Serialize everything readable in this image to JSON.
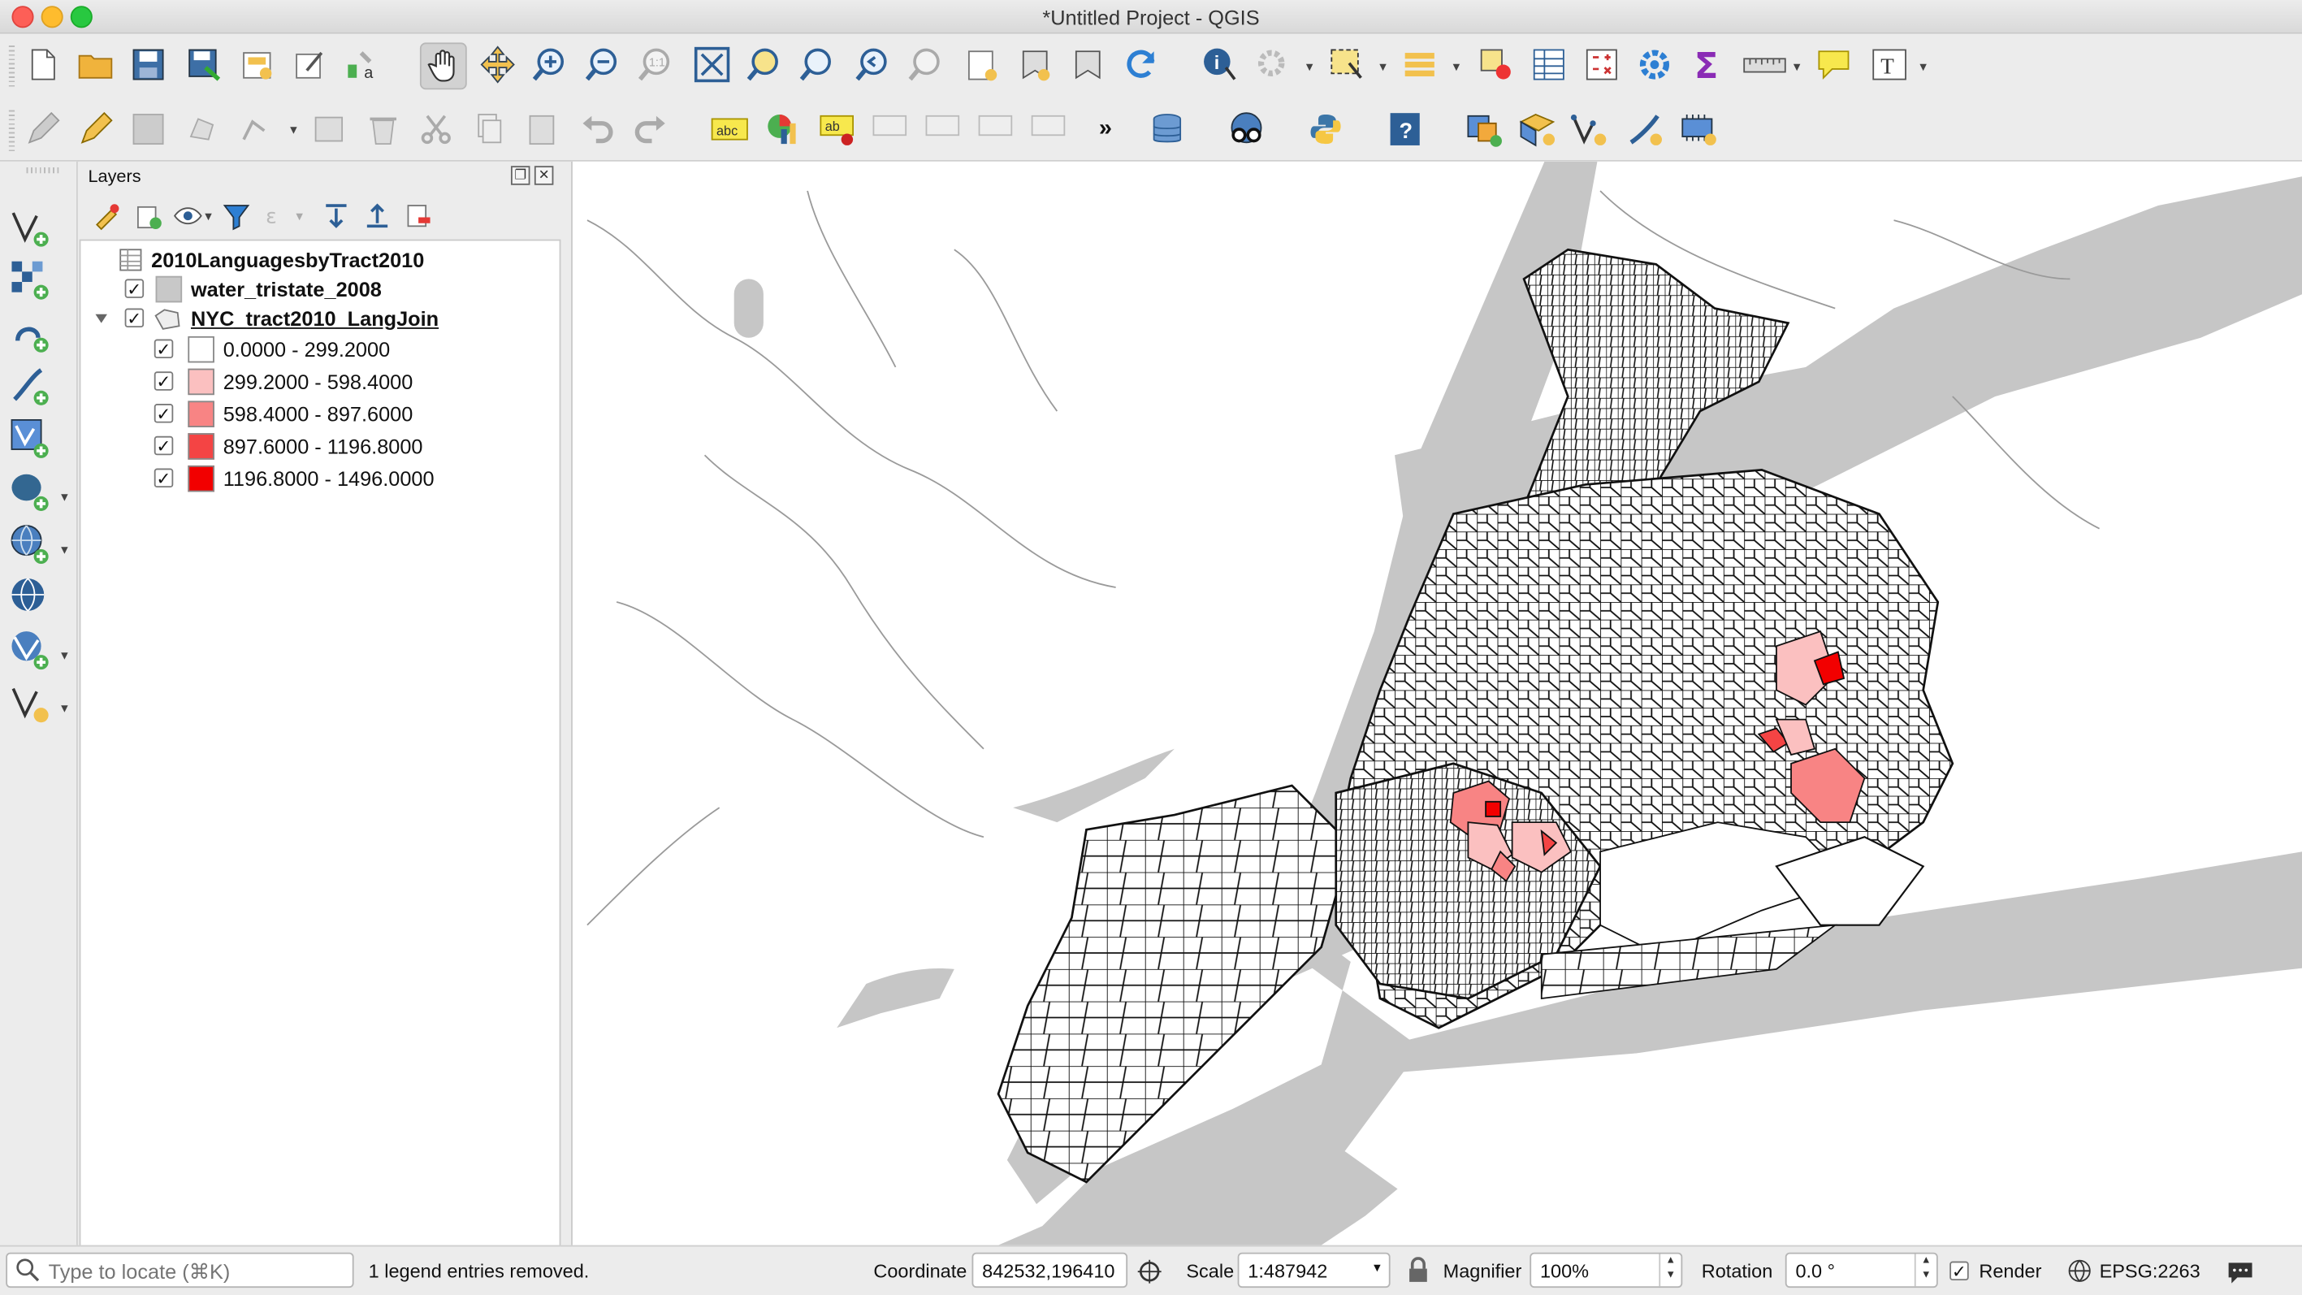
{
  "window": {
    "title": "*Untitled Project - QGIS"
  },
  "layers_panel": {
    "title": "Layers",
    "items": [
      {
        "name": "2010LanguagesbyTract2010",
        "type": "table",
        "checked": null
      },
      {
        "name": "water_tristate_2008",
        "type": "polygon-fill",
        "checked": true,
        "color": "#c8c8c8"
      },
      {
        "name": "NYC_tract2010_LangJoin",
        "type": "polygon",
        "checked": true,
        "expanded": true
      }
    ],
    "classes": [
      {
        "label": "0.0000 - 299.2000",
        "color": "#ffffff",
        "checked": true
      },
      {
        "label": "299.2000 - 598.4000",
        "color": "#fbc0c0",
        "checked": true
      },
      {
        "label": "598.4000 - 897.6000",
        "color": "#f88484",
        "checked": true
      },
      {
        "label": "897.6000 - 1196.8000",
        "color": "#f44444",
        "checked": true
      },
      {
        "label": "1196.8000 - 1496.0000",
        "color": "#f20000",
        "checked": true
      }
    ]
  },
  "status": {
    "locate_placeholder": "Type to locate (⌘K)",
    "message": "1 legend entries removed.",
    "coordinate_label": "Coordinate",
    "coordinate_value": "842532,196410",
    "scale_label": "Scale",
    "scale_value": "1:487942",
    "magnifier_label": "Magnifier",
    "magnifier_value": "100%",
    "rotation_label": "Rotation",
    "rotation_value": "0.0 °",
    "render_label": "Render",
    "render_checked": true,
    "crs": "EPSG:2263"
  },
  "colors": {
    "water": "#c6c6c6",
    "tract_outline": "#111111",
    "accent_red": "#f20000"
  }
}
